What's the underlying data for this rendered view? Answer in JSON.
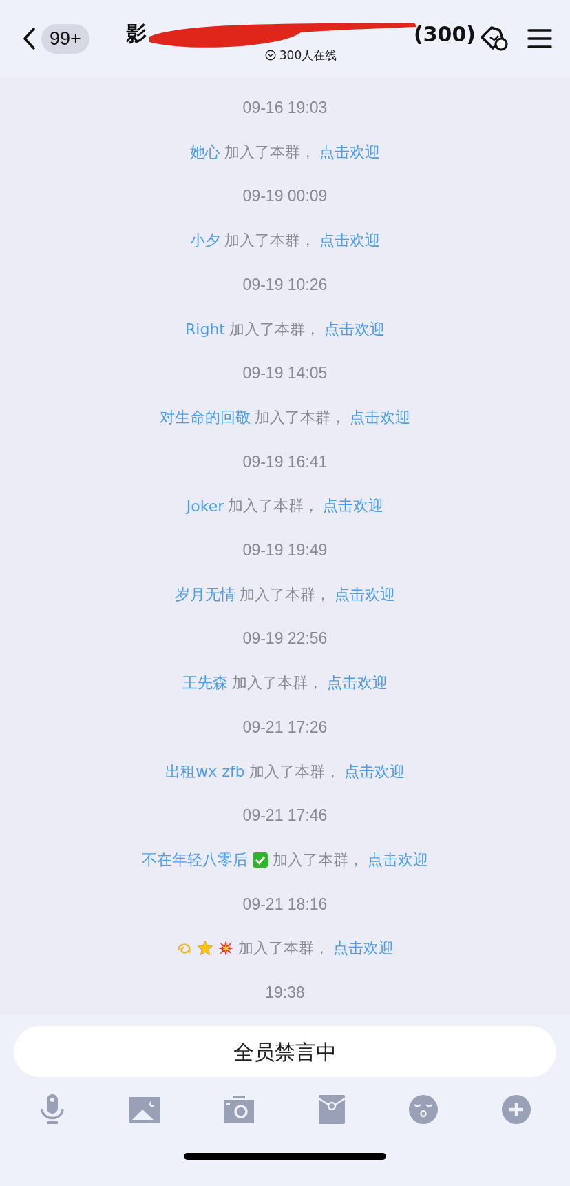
{
  "header": {
    "unread_badge": "99+",
    "title_start": "影",
    "title_count": "(300)",
    "redacted": true,
    "online": "300人在线"
  },
  "messages": [
    {
      "kind": "time",
      "text": "09-16 19:03"
    },
    {
      "kind": "join",
      "name": "她心",
      "action": "加入了本群，",
      "link": "点击欢迎"
    },
    {
      "kind": "time",
      "text": "09-19 00:09"
    },
    {
      "kind": "join",
      "name": "小夕",
      "action": "加入了本群，",
      "link": "点击欢迎"
    },
    {
      "kind": "time",
      "text": "09-19 10:26"
    },
    {
      "kind": "join",
      "name": "Right",
      "action": "加入了本群，",
      "link": "点击欢迎"
    },
    {
      "kind": "time",
      "text": "09-19 14:05"
    },
    {
      "kind": "join",
      "name": "对生命的回敬",
      "action": "加入了本群，",
      "link": "点击欢迎"
    },
    {
      "kind": "time",
      "text": "09-19 16:41"
    },
    {
      "kind": "join",
      "name": "Joker",
      "action": "加入了本群，",
      "link": "点击欢迎"
    },
    {
      "kind": "time",
      "text": "09-19 19:49"
    },
    {
      "kind": "join",
      "name": "岁月无情",
      "action": "加入了本群，",
      "link": "点击欢迎"
    },
    {
      "kind": "time",
      "text": "09-19 22:56"
    },
    {
      "kind": "join",
      "name": "王先森",
      "action": "加入了本群，",
      "link": "点击欢迎"
    },
    {
      "kind": "time",
      "text": "09-21 17:26"
    },
    {
      "kind": "join",
      "name": "出租wx zfb",
      "action": "加入了本群，",
      "link": "点击欢迎"
    },
    {
      "kind": "time",
      "text": "09-21 17:46"
    },
    {
      "kind": "join",
      "name": "不在年轻八零后",
      "badges": [
        {
          "kind": "check"
        }
      ],
      "action": "加入了本群，",
      "link": "点击欢迎"
    },
    {
      "kind": "time",
      "text": "09-21 18:16"
    },
    {
      "kind": "join",
      "badges": [
        {
          "kind": "dizzy"
        },
        {
          "kind": "star"
        },
        {
          "kind": "burst"
        }
      ],
      "action": "加入了本群，",
      "link": "点击欢迎"
    },
    {
      "kind": "time",
      "text": "19:38"
    }
  ],
  "input": {
    "placeholder": "全员禁言中"
  },
  "toolbar": [
    {
      "kind": "mic"
    },
    {
      "kind": "image"
    },
    {
      "kind": "camera"
    },
    {
      "kind": "redpacket"
    },
    {
      "kind": "emoji"
    },
    {
      "kind": "plus"
    }
  ]
}
